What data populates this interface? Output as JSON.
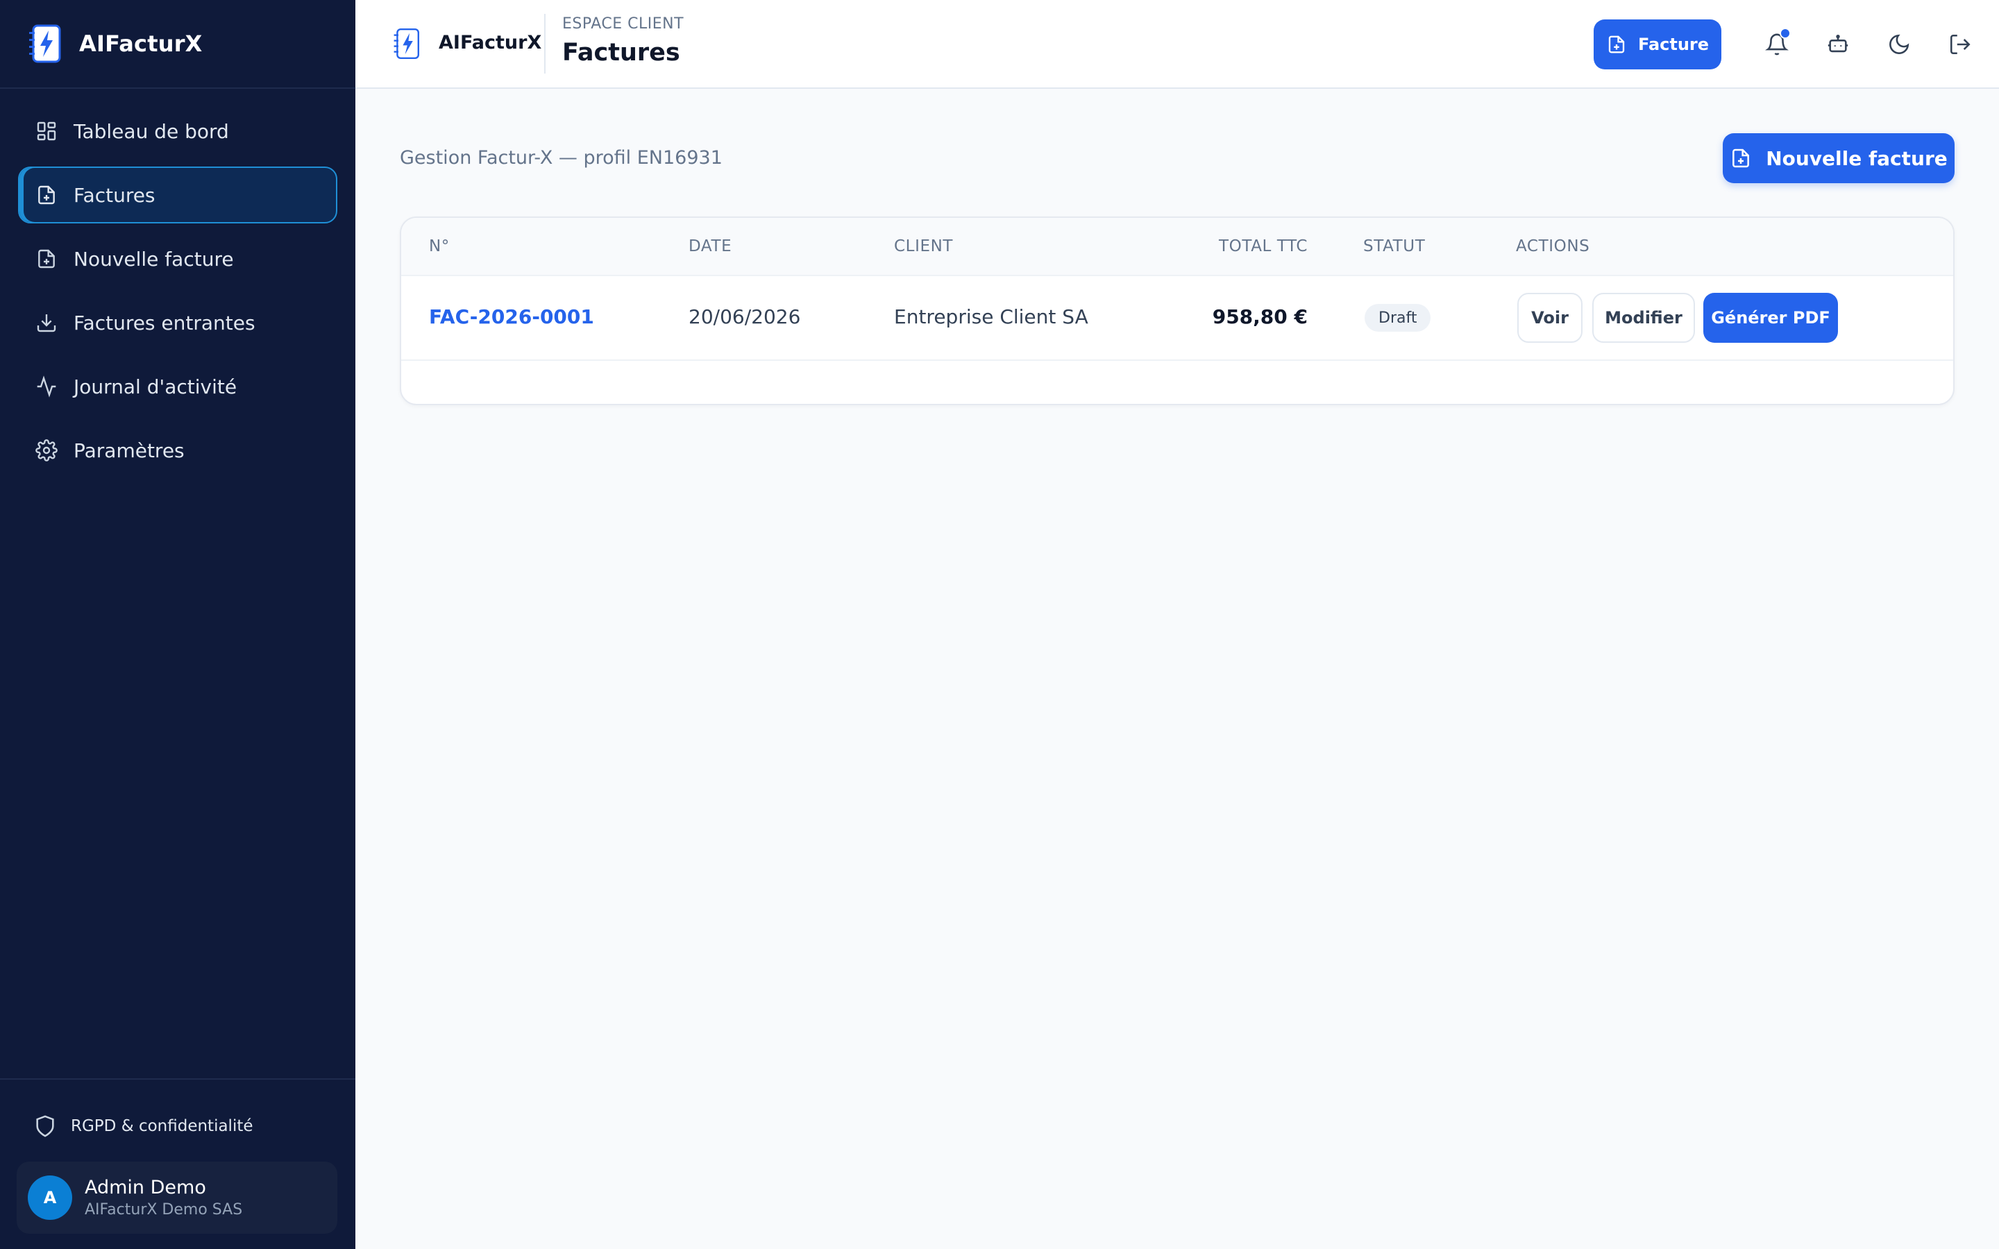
{
  "app": {
    "name": "AIFacturX"
  },
  "sidebar": {
    "items": [
      {
        "label": "Tableau de bord",
        "icon": "dashboard-icon"
      },
      {
        "label": "Factures",
        "icon": "file-plus-icon",
        "active": true
      },
      {
        "label": "Nouvelle facture",
        "icon": "file-plus-icon"
      },
      {
        "label": "Factures entrantes",
        "icon": "download-icon"
      },
      {
        "label": "Journal d'activité",
        "icon": "activity-icon"
      },
      {
        "label": "Paramètres",
        "icon": "gear-icon"
      }
    ],
    "rgpd_label": "RGPD & confidentialité",
    "user": {
      "initial": "A",
      "name": "Admin Demo",
      "org": "AIFacturX Demo SAS"
    }
  },
  "topbar": {
    "brand": "AIFacturX",
    "eyebrow": "ESPACE CLIENT",
    "title": "Factures",
    "cta_label": "Facture",
    "icons": [
      "bell-icon",
      "robot-icon",
      "moon-icon",
      "logout-icon"
    ],
    "has_notification": true
  },
  "main": {
    "subtitle": "Gestion Factur-X — profil EN16931",
    "new_button_label": "Nouvelle facture",
    "table": {
      "headers": [
        "N°",
        "DATE",
        "CLIENT",
        "TOTAL TTC",
        "STATUT",
        "ACTIONS"
      ],
      "rows": [
        {
          "number": "FAC-2026-0001",
          "date": "20/06/2026",
          "client": "Entreprise Client SA",
          "total": "958,80 €",
          "status": "Draft",
          "actions": {
            "view": "Voir",
            "edit": "Modifier",
            "pdf": "Générer PDF"
          }
        }
      ]
    }
  },
  "colors": {
    "sidebar_bg": "#0f1a3a",
    "accent": "#2563eb",
    "active_border": "#1f8fd6",
    "page_bg": "#f8fafc"
  }
}
